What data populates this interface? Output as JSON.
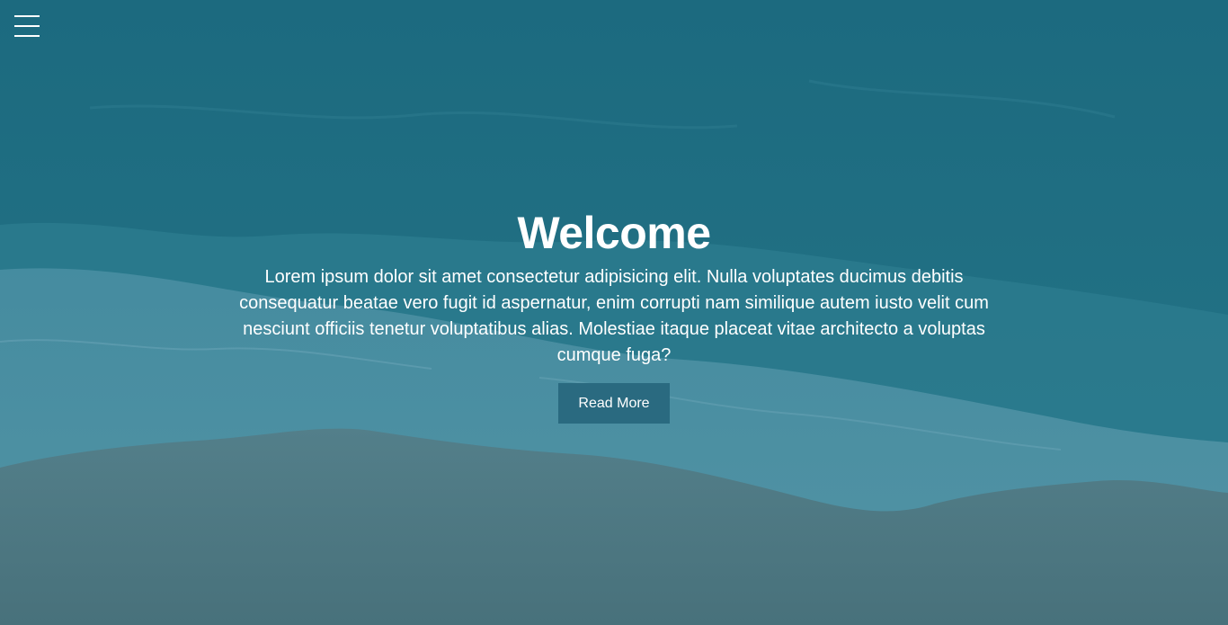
{
  "menu": {
    "icon": "hamburger-menu-icon"
  },
  "hero": {
    "title": "Welcome",
    "text": "Lorem ipsum dolor sit amet consectetur adipisicing elit. Nulla voluptates ducimus debitis consequatur beatae vero fugit id aspernatur, enim corrupti nam similique autem iusto velit cum nesciunt officiis tenetur voluptatibus alias. Molestiae itaque placeat vitae architecto a voluptas cumque fuga?",
    "button_label": "Read More"
  },
  "colors": {
    "overlay": "#1f6c80",
    "button": "#2a6a80",
    "text": "#ffffff"
  }
}
